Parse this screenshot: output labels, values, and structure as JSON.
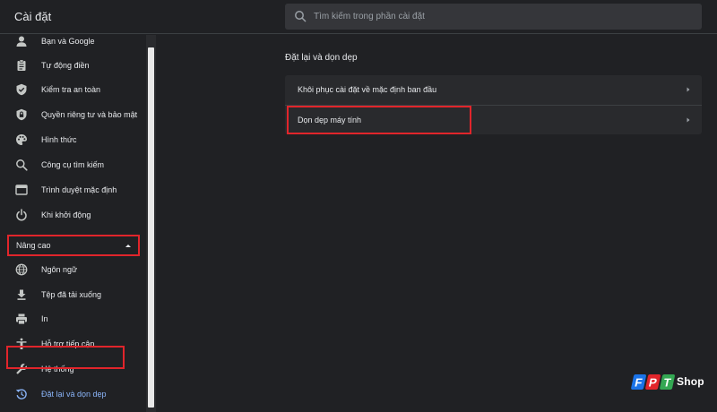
{
  "header": {
    "title": "Cài đặt",
    "search_placeholder": "Tìm kiếm trong phần cài đặt"
  },
  "sidebar": {
    "items": [
      {
        "label": "Bạn và Google",
        "icon": "person-icon"
      },
      {
        "label": "Tự động điền",
        "icon": "clipboard-icon"
      },
      {
        "label": "Kiểm tra an toàn",
        "icon": "shield-check-icon"
      },
      {
        "label": "Quyền riêng tư và bảo mật",
        "icon": "shield-lock-icon"
      },
      {
        "label": "Hình thức",
        "icon": "palette-icon"
      },
      {
        "label": "Công cụ tìm kiếm",
        "icon": "search-icon"
      },
      {
        "label": "Trình duyệt mặc định",
        "icon": "browser-icon"
      },
      {
        "label": "Khi khởi động",
        "icon": "power-icon"
      }
    ],
    "advanced": {
      "label": "Nâng cao",
      "icon": "caret-up-icon"
    },
    "advanced_items": [
      {
        "label": "Ngôn ngữ",
        "icon": "globe-icon"
      },
      {
        "label": "Tệp đã tải xuống",
        "icon": "download-icon"
      },
      {
        "label": "In",
        "icon": "printer-icon"
      },
      {
        "label": "Hỗ trợ tiếp cận",
        "icon": "accessibility-icon"
      },
      {
        "label": "Hệ thống",
        "icon": "wrench-icon"
      },
      {
        "label": "Đặt lại và dọn dẹp",
        "icon": "restore-icon",
        "active": true
      }
    ]
  },
  "main": {
    "section_title": "Đặt lại và dọn dẹp",
    "rows": [
      {
        "label": "Khôi phục cài đặt về mặc định ban đầu"
      },
      {
        "label": "Dọn dẹp máy tính"
      }
    ]
  },
  "watermark": {
    "letters": [
      "F",
      "P",
      "T"
    ],
    "word": "Shop",
    "colors": {
      "blue": "#1a73e8",
      "red": "#e1252b",
      "green": "#34a853"
    }
  },
  "colors": {
    "background": "#202124",
    "card": "#292a2d",
    "text": "#e8eaed",
    "accent": "#8ab4f8",
    "highlight": "#e1252b"
  }
}
